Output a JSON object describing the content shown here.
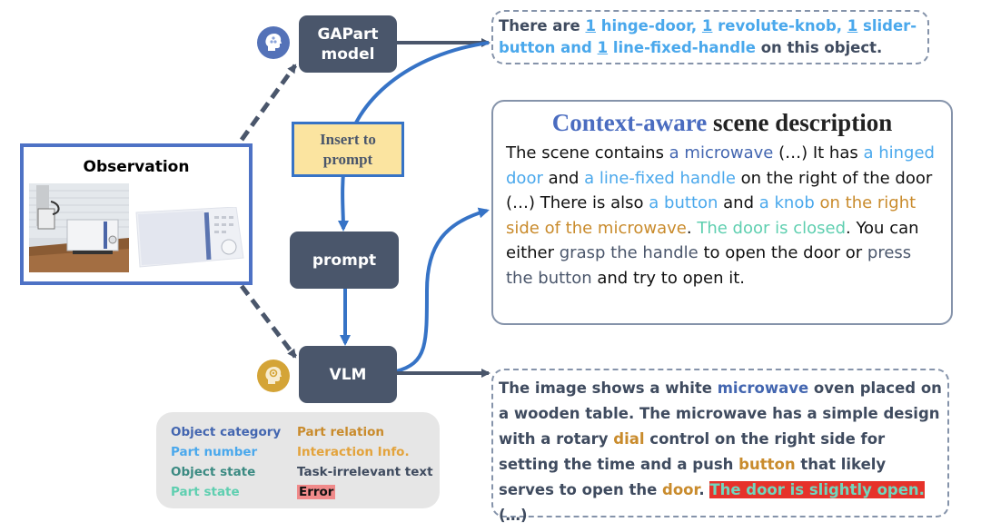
{
  "colors": {
    "node_bg": "#4a566b",
    "flow_blue": "#3673c6",
    "observation_border": "#4e72c5",
    "insert_bg": "#fbe4a0",
    "object_category": "#4366b0",
    "part_number": "#4aa8ec",
    "object_state": "#3b8a82",
    "part_state": "#5fcfb0",
    "part_relation": "#c98b2c",
    "interaction_info": "#e3a33c",
    "task_irrelevant": "#3f4b5f",
    "error_bg": "#e6322a"
  },
  "nodes": {
    "gapart": "GAPart model",
    "gapart_line1": "GAPart",
    "gapart_line2": "model",
    "prompt": "prompt",
    "vlm": "VLM",
    "insert_line1": "Insert to",
    "insert_line2": "prompt"
  },
  "icons": {
    "gapart_icon": "ai-head-icon",
    "vlm_icon": "gear-head-icon"
  },
  "observation": {
    "title": "Observation",
    "images": [
      "robot-arm-microwave-photo",
      "microwave-pointcloud-render"
    ]
  },
  "gapart_output": {
    "p1": "There are ",
    "n1": "1",
    "t1": " hinge-door, ",
    "n2": "1",
    "t2": " revolute-knob, ",
    "n3": "1",
    "t3": " slider-button and ",
    "n4": "1",
    "t4": " line-fixed-handle",
    "p2": " on this object."
  },
  "context": {
    "title_highlight": "Context-aware",
    "title_rest": " scene description",
    "s1": "The scene contains ",
    "s2": "a microwave",
    "s3": " (…) It has ",
    "s4": "a hinged door",
    "s5": " and ",
    "s6": "a line-fixed handle",
    "s7": " on the right of the door (…) There is also ",
    "s8": "a button",
    "s9": " and ",
    "s10": "a knob",
    "s11": " ",
    "s12": "on the right side of the microwave",
    "s13": ". ",
    "s14": "The door is closed",
    "s15": ". You can either ",
    "s16": "grasp the handle",
    "s17": " to open the door or ",
    "s18": "press the button",
    "s19": " and try to open it."
  },
  "vlm_output": {
    "v1": "The image shows a white ",
    "v2": "microwave",
    "v3": " oven placed on a wooden table. The microwave has a simple design with a rotary ",
    "v4": "dial",
    "v5": " control on the right side for setting the time and a push ",
    "v6": "button",
    "v7": " that likely serves to open the ",
    "v8": "door",
    "v9": ". ",
    "v10": "The door is slightly open.",
    "v11": " (…)"
  },
  "legend": {
    "items": [
      "Object category",
      "Part number",
      "Object state",
      "Part state",
      "Part relation",
      "Interaction Info.",
      "Task-irrelevant text",
      "Error"
    ]
  }
}
